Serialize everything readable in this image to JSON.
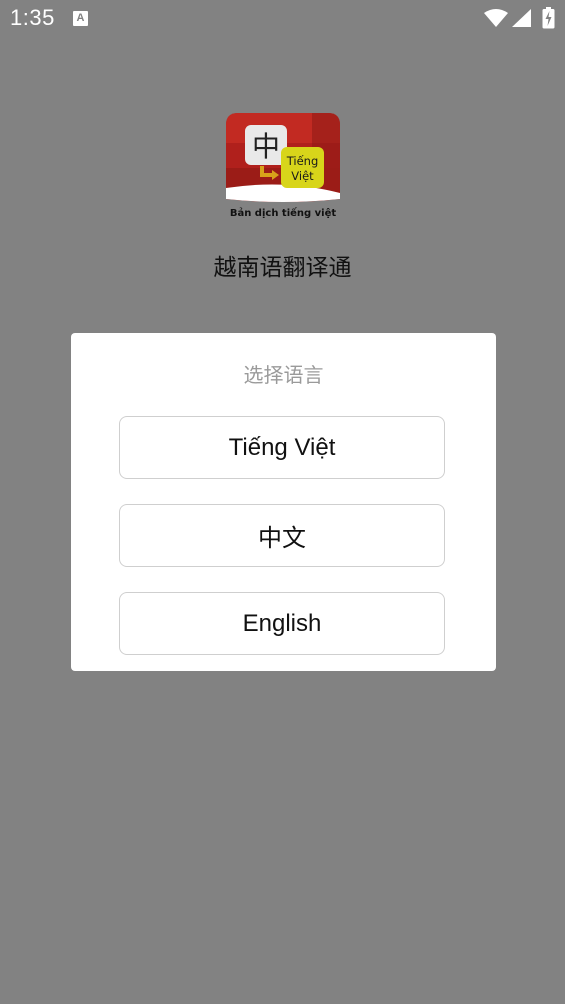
{
  "status_bar": {
    "time": "1:35",
    "notification_icon": "font-a-icon",
    "wifi_icon": "wifi-icon",
    "signal_icon": "cell-signal-icon",
    "battery_icon": "battery-charging-icon"
  },
  "app": {
    "logo": {
      "glyph": "中",
      "badge_line1": "Tiếng",
      "badge_line2": "Việt",
      "caption": "Bản dịch tiếng việt",
      "colors": {
        "background": "#b0201c",
        "badge": "#d8d51a"
      }
    },
    "title": "越南语翻译通"
  },
  "dialog": {
    "title": "选择语言",
    "options": [
      {
        "label": "Tiếng Việt"
      },
      {
        "label": "中文"
      },
      {
        "label": "English"
      }
    ]
  }
}
